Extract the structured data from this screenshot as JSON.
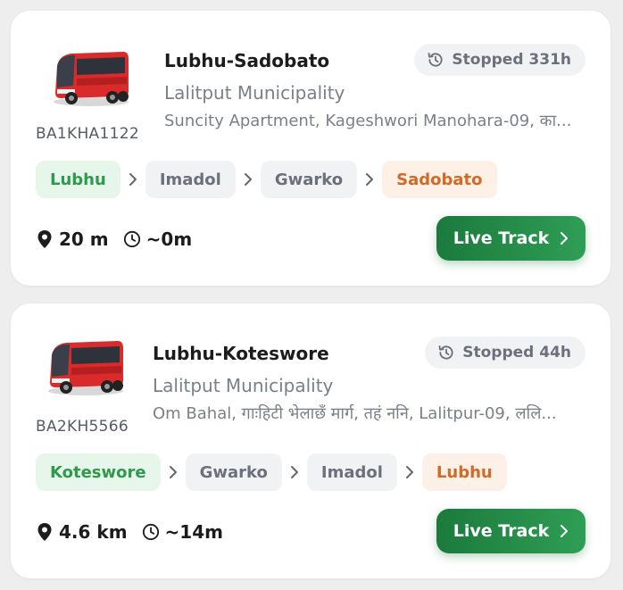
{
  "cards": [
    {
      "vehicle_number": "BA1KHA1122",
      "route_name": "Lubhu-Sadobato",
      "municipality": "Lalitput Municipality",
      "address": "Suncity Apartment, Kageshwori Manohara-09, का...",
      "status": "Stopped 331h",
      "stops": [
        "Lubhu",
        "Imadol",
        "Gwarko",
        "Sadobato"
      ],
      "distance": "20 m",
      "eta": "~0m",
      "action_label": "Live Track"
    },
    {
      "vehicle_number": "BA2KH5566",
      "route_name": "Lubhu-Koteswore",
      "municipality": "Lalitput Municipality",
      "address": "Om Bahal, गाःहिटी भेलाछँ मार्ग, तहं ननि, Lalitpur-09, ललि...",
      "status": "Stopped 44h",
      "stops": [
        "Koteswore",
        "Gwarko",
        "Imadol",
        "Lubhu"
      ],
      "distance": "4.6 km",
      "eta": "~14m",
      "action_label": "Live Track"
    }
  ],
  "colors": {
    "primary_button": "#1f8a45",
    "stop_first": "#2e9a4b",
    "stop_last": "#d26a26",
    "badge_bg": "#f1f2f4"
  },
  "icons": {
    "status": "history-icon",
    "distance": "location-pin-icon",
    "eta": "clock-icon",
    "separator": "chevron-right-icon",
    "button": "chevron-right-icon",
    "vehicle": "bus-icon"
  }
}
